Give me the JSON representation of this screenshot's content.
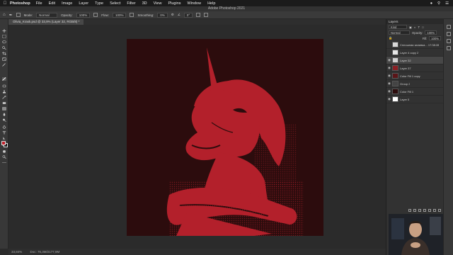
{
  "menubar": {
    "app": "Photoshop",
    "items": [
      "File",
      "Edit",
      "Image",
      "Layer",
      "Type",
      "Select",
      "Filter",
      "3D",
      "View",
      "Plugins",
      "Window",
      "Help"
    ]
  },
  "window": {
    "title": "Adobe Photoshop 2021"
  },
  "options": {
    "mode_label": "Mode:",
    "mode_value": "Normal",
    "opacity_label": "Opacity:",
    "opacity_value": "100%",
    "flow_label": "Flow:",
    "flow_value": "100%",
    "smoothing_label": "Smoothing:",
    "smoothing_value": "0%",
    "angle_value": "0°"
  },
  "document": {
    "tab_label": "Olivia_Krask.psd @ 33,9% (Layer 32, RGB/8) *"
  },
  "status": {
    "zoom": "33,84%",
    "doc": "Doc: 76,3M/2177,9M"
  },
  "layers_panel": {
    "title": "Layers",
    "filter": "Kind",
    "blend_mode": "Normal",
    "opacity_label": "Opacity:",
    "opacity_value": "100%",
    "fill_label": "Fill:",
    "fill_value": "100%",
    "layers": [
      {
        "name": "Сплошная заливка... 17:38:28",
        "thumb": "#d8d8d8",
        "eye": false,
        "selected": false
      },
      {
        "name": "Layer 4 copy 2",
        "thumb": "#e6e6e6",
        "eye": false,
        "selected": false
      },
      {
        "name": "Layer 32",
        "thumb": "#d0d0d0",
        "eye": true,
        "selected": true
      },
      {
        "name": "Layer 37",
        "thumb": "#8a1f24",
        "eye": true,
        "selected": false
      },
      {
        "name": "Color Fill 1 copy",
        "thumb": "#5a1518",
        "eye": true,
        "selected": false
      },
      {
        "name": "Group 2",
        "thumb": "#444444",
        "eye": true,
        "selected": false
      },
      {
        "name": "Color Fill 1",
        "thumb": "#2c0c0d",
        "eye": true,
        "selected": false
      },
      {
        "name": "Layer 5",
        "thumb": "#ffffff",
        "eye": true,
        "selected": false
      }
    ]
  },
  "colors": {
    "artboard": "#2c0c0d",
    "illustration": "#b3202b",
    "foreground": "#c0202a"
  }
}
